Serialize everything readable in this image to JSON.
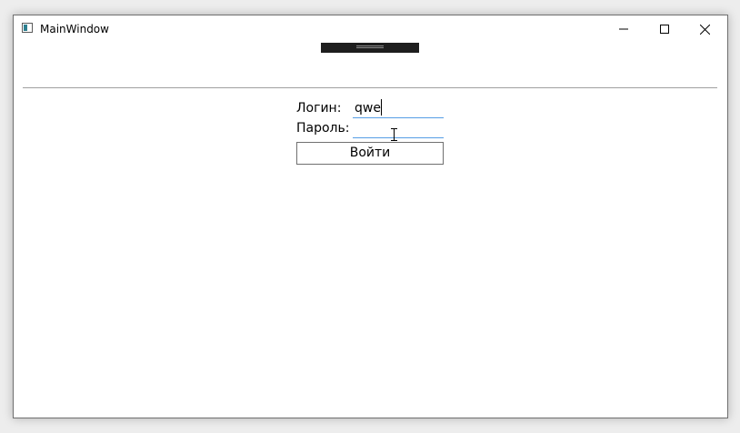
{
  "window": {
    "title": "MainWindow",
    "icon": "app-window-icon",
    "controls": {
      "minimize": "minimize-icon",
      "maximize": "maximize-icon",
      "close": "close-icon"
    }
  },
  "form": {
    "login_label": "Логин:",
    "login_value": "qwe",
    "password_label": "Пароль:",
    "password_value": "",
    "submit_label": "Войти"
  },
  "colors": {
    "input_underline": "#569de5",
    "separator": "#a0a0a0",
    "drag_strip": "#1e1e1e"
  }
}
